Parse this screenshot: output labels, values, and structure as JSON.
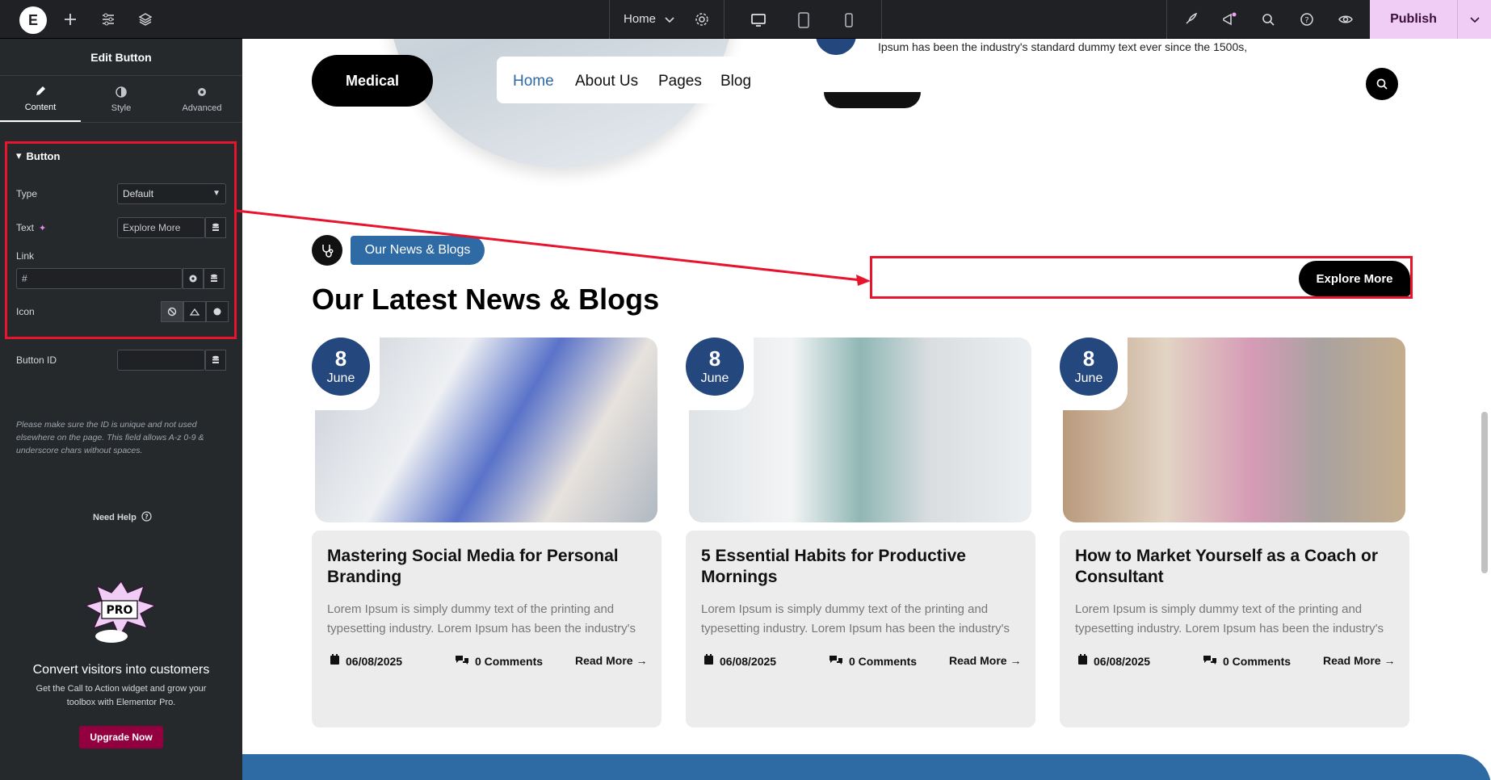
{
  "topbar": {
    "page_name": "Home",
    "publish_label": "Publish"
  },
  "sidebar": {
    "title": "Edit Button",
    "tabs": [
      {
        "label": "Content",
        "icon": "pencil-icon",
        "active": true
      },
      {
        "label": "Style",
        "icon": "half-circle-icon",
        "active": false
      },
      {
        "label": "Advanced",
        "icon": "gear-icon",
        "active": false
      }
    ],
    "section_title": "Button",
    "type_label": "Type",
    "type_value": "Default",
    "text_label": "Text",
    "text_value": "Explore More",
    "link_label": "Link",
    "link_placeholder": "#",
    "icon_label": "Icon",
    "button_id_label": "Button ID",
    "help_text": "Please make sure the ID is unique and not used elsewhere on the page. This field allows A-z 0-9 & underscore chars without spaces.",
    "need_help": "Need Help",
    "promo_title": "Convert visitors into customers",
    "promo_text": "Get the Call to Action widget and grow your toolbox with Elementor Pro.",
    "upgrade_label": "Upgrade Now"
  },
  "canvas": {
    "hero_text": "Ipsum has been the industry's standard dummy text ever since the 1500s,",
    "logo": "Medical",
    "nav": [
      "Home",
      "About Us",
      "Pages",
      "Blog"
    ],
    "badge": "Our News & Blogs",
    "section_title": "Our Latest News & Blogs",
    "explore_button": "Explore More",
    "cards": [
      {
        "day": "8",
        "month": "June",
        "title": "Mastering Social Media for Personal Branding",
        "excerpt": "Lorem Ipsum is simply dummy text of the printing and typesetting industry. Lorem Ipsum has been the industry's",
        "date": "06/08/2025",
        "comments": "0 Comments",
        "read_more": "Read More →"
      },
      {
        "day": "8",
        "month": "June",
        "title": "5 Essential Habits for Productive Mornings",
        "excerpt": "Lorem Ipsum is simply dummy text of the printing and typesetting industry. Lorem Ipsum has been the industry's",
        "date": "06/08/2025",
        "comments": "0 Comments",
        "read_more": "Read More →"
      },
      {
        "day": "8",
        "month": "June",
        "title": "How to Market Yourself as a Coach or Consultant",
        "excerpt": "Lorem Ipsum is simply dummy text of the printing and typesetting industry. Lorem Ipsum has been the industry's",
        "date": "06/08/2025",
        "comments": "0 Comments",
        "read_more": "Read More →"
      }
    ]
  },
  "colors": {
    "accent_blue": "#2e6aa3",
    "dark_blue": "#24477e",
    "highlight_red": "#e8132d",
    "publish_pink": "#f0cdf5",
    "upgrade": "#93003f"
  }
}
